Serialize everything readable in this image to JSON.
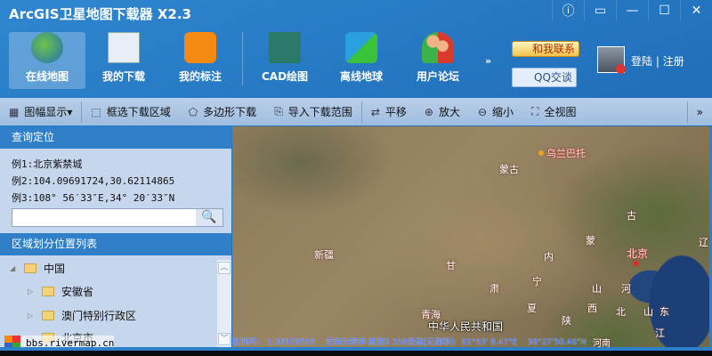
{
  "window": {
    "title": "ArcGIS卫星地图下载器 X2.3",
    "buttons": [
      "ⓘ",
      "▭",
      "—",
      "☐",
      "✕"
    ]
  },
  "main_toolbar": [
    {
      "label": "在线地图",
      "icon": "globe-icon",
      "color": "#3a9a3a",
      "active": true
    },
    {
      "label": "我的下载",
      "icon": "download-list-icon",
      "color": "#e8eef8"
    },
    {
      "label": "我的标注",
      "icon": "map-pin-icon",
      "color": "#f58a10"
    },
    {
      "label": "CAD绘图",
      "icon": "cad-icon",
      "color": "#2a7a6a"
    },
    {
      "label": "离线地球",
      "icon": "cubes-icon",
      "color": "#2aa0e0"
    },
    {
      "label": "用户论坛",
      "icon": "users-icon",
      "color": "#d93a2a"
    }
  ],
  "more": "»",
  "contact": {
    "label": "和我联系",
    "qq": "QQ交谈"
  },
  "user": {
    "login": "登陆",
    "sep": "|",
    "register": "注册"
  },
  "sub_toolbar": [
    {
      "label": "图幅显示▾",
      "icon": "grid-icon",
      "glyph": "▦"
    },
    {
      "label": "框选下载区域",
      "icon": "select-rect-icon",
      "glyph": "⬚"
    },
    {
      "label": "多边形下载",
      "icon": "pentagon-icon",
      "glyph": "⬠"
    },
    {
      "label": "导入下载范围",
      "icon": "import-icon",
      "glyph": "⎘"
    },
    {
      "label": "平移",
      "icon": "pan-icon",
      "glyph": "⇄"
    },
    {
      "label": "放大",
      "icon": "zoom-in-icon",
      "glyph": "⊕"
    },
    {
      "label": "缩小",
      "icon": "zoom-out-icon",
      "glyph": "⊖"
    },
    {
      "label": "全视图",
      "icon": "full-extent-icon",
      "glyph": "⛶"
    }
  ],
  "sub_more": "»",
  "query": {
    "title": "查询定位",
    "examples": [
      "例1:北京紫禁城",
      "例2:104.09691724,30.62114865",
      "例3:108° 56′33″E,34° 20′33″N"
    ],
    "value": "",
    "search_glyph": "🔍"
  },
  "regions": {
    "title": "区域划分位置列表",
    "nodes": [
      {
        "label": "中国",
        "arrow": "◢"
      },
      {
        "label": "安徽省",
        "arrow": "▷"
      },
      {
        "label": "澳门特别行政区",
        "arrow": "▷"
      },
      {
        "label": "北京市",
        "arrow": "▷"
      }
    ],
    "scroll_up": "︿",
    "scroll_down": "﹀"
  },
  "watermark": "bbs.rivermap.cn",
  "map_labels": {
    "ulaanbaatar": "乌兰巴托",
    "mongolia": "蒙古",
    "gu": "古",
    "meng": "蒙",
    "beijing": "北京",
    "nei": "内",
    "gan": "甘",
    "xinjiang": "新疆",
    "ning": "宁",
    "su": "肃",
    "shan1": "山",
    "he1": "河",
    "xia": "夏",
    "xi": "西",
    "bei": "北",
    "shan2": "山",
    "dong": "东",
    "qinghai": "青海",
    "shaan": "陕",
    "jiang": "江",
    "prc": "中华人民共和国",
    "liao": "辽",
    "henan": "河南"
  },
  "status": "比例尺： 1:36978595    空间分辨率:级别3 358坐标[无偏移]:  92°53' 8.47\"E    38°27'50.46\"N"
}
